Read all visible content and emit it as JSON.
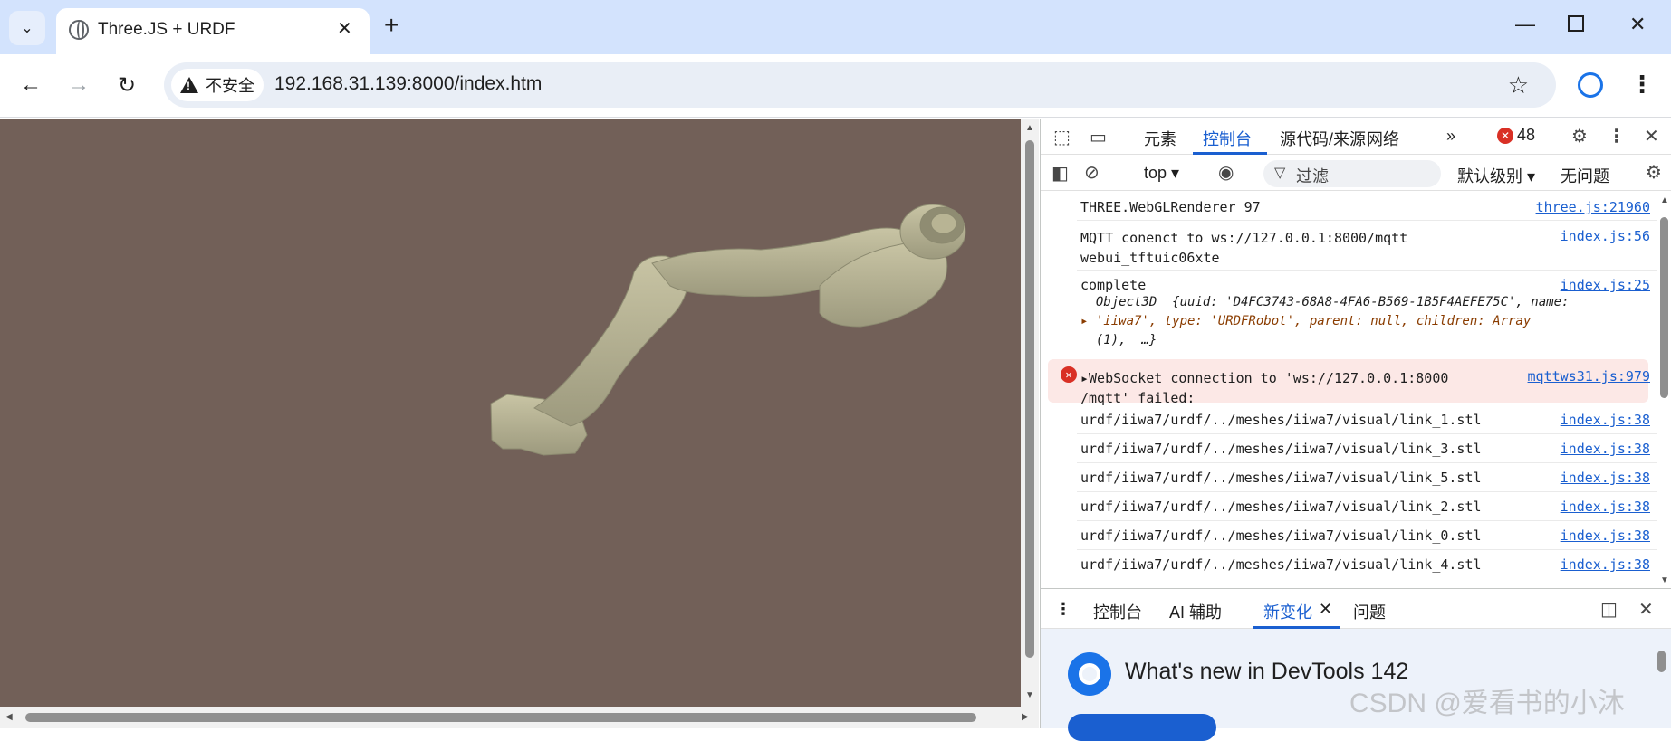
{
  "browser": {
    "tab_title": "Three.JS + URDF",
    "security_label": "不安全",
    "url": "192.168.31.139:8000/index.htm"
  },
  "devtools": {
    "tabs": [
      "元素",
      "控制台",
      "源代码/来源",
      "网络"
    ],
    "active_tab": "控制台",
    "error_count": "48",
    "context": "top",
    "filter_placeholder": "过滤",
    "levels_label": "默认级别",
    "issues_label": "无问题",
    "console": [
      {
        "text": "THREE.WebGLRenderer 97",
        "src": "three.js:21960"
      },
      {
        "text": "MQTT conenct to ws://127.0.0.1:8000/mqtt\nwebui_tftuic06xte",
        "src": "index.js:56"
      },
      {
        "text": "complete",
        "src": "index.js:25"
      },
      {
        "text": "  Object3D  {uuid: 'D4FC3743-68A8-4FA6-B569-1B5F4AEFE75C', name:",
        "src": ""
      },
      {
        "text": "▸ 'iiwa7', type: 'URDFRobot', parent: null, children: Array",
        "src": ""
      },
      {
        "text": "  (1),  …}",
        "src": ""
      },
      {
        "text": "▸WebSocket connection to 'ws://127.0.0.1:8000\n/mqtt' failed:",
        "src": "mqttws31.js:979"
      },
      {
        "text": "urdf/iiwa7/urdf/../meshes/iiwa7/visual/link_1.stl",
        "src": "index.js:38"
      },
      {
        "text": "urdf/iiwa7/urdf/../meshes/iiwa7/visual/link_3.stl",
        "src": "index.js:38"
      },
      {
        "text": "urdf/iiwa7/urdf/../meshes/iiwa7/visual/link_5.stl",
        "src": "index.js:38"
      },
      {
        "text": "urdf/iiwa7/urdf/../meshes/iiwa7/visual/link_2.stl",
        "src": "index.js:38"
      },
      {
        "text": "urdf/iiwa7/urdf/../meshes/iiwa7/visual/link_0.stl",
        "src": "index.js:38"
      },
      {
        "text": "urdf/iiwa7/urdf/../meshes/iiwa7/visual/link_4.stl",
        "src": "index.js:38"
      }
    ],
    "drawer_tabs": [
      "控制台",
      "AI 辅助",
      "新变化",
      "问题"
    ],
    "drawer_active": "新变化",
    "whats_new_title": "What's new in DevTools 142"
  },
  "watermark": "CSDN @爱看书的小沐",
  "colors": {
    "viewport_bg": "#726058",
    "robot": "#b8b494",
    "accent": "#1a5fd0",
    "error": "#d93025"
  }
}
